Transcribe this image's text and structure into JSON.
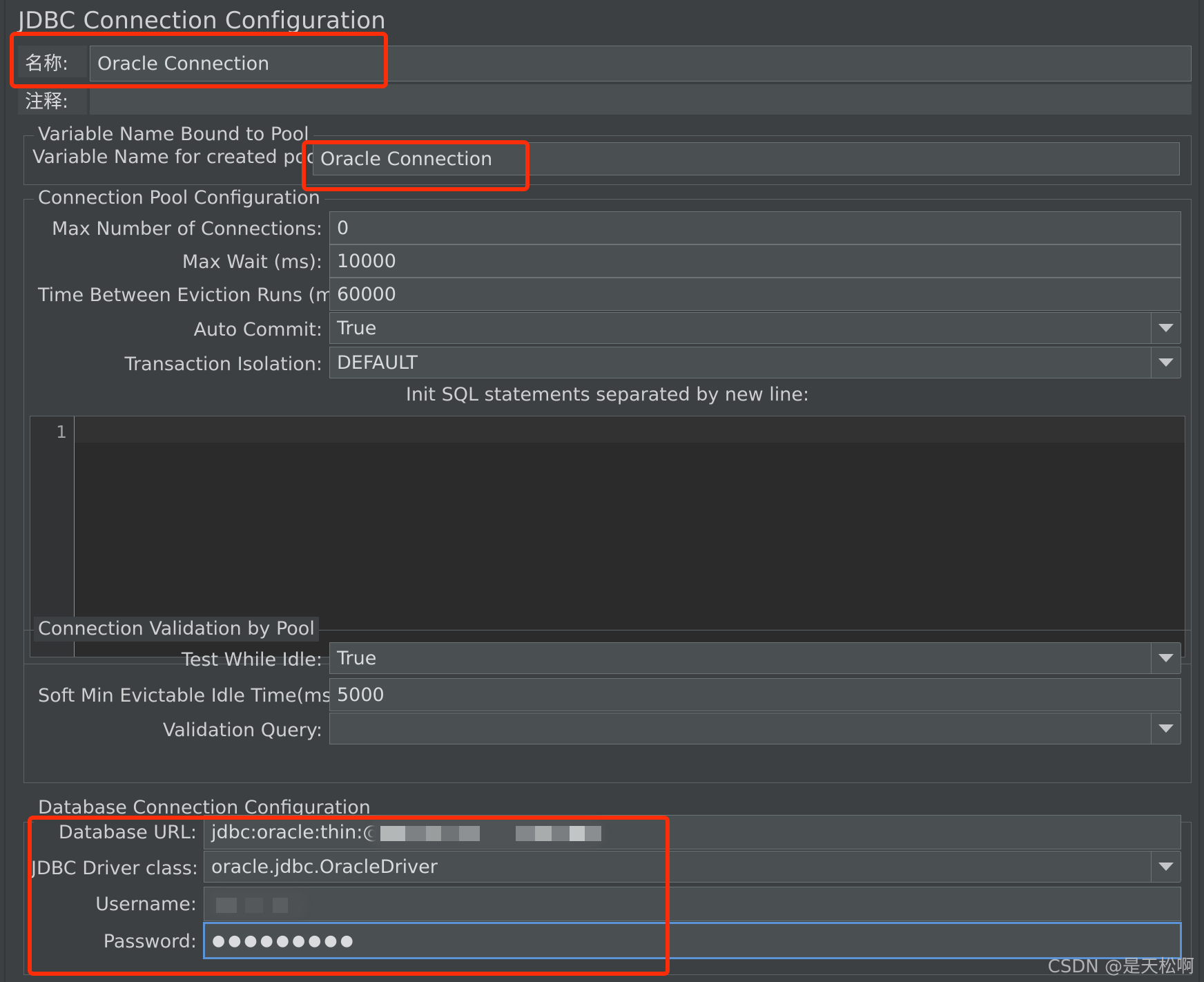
{
  "window": {
    "title": "JDBC Connection Configuration"
  },
  "header": {
    "name_label": "名称:",
    "name_value": "Oracle Connection",
    "comment_label": "注释:",
    "comment_value": ""
  },
  "variable_group": {
    "title": "Variable Name Bound to Pool",
    "pool_label": "Variable Name for created pool",
    "pool_value": "Oracle Connection"
  },
  "pool_group": {
    "title": "Connection Pool Configuration",
    "rows": [
      {
        "label": "Max Number of Connections:",
        "value": "0",
        "type": "text"
      },
      {
        "label": "Max Wait (ms):",
        "value": "10000",
        "type": "text"
      },
      {
        "label": "Time Between Eviction Runs (ms):",
        "value": "60000",
        "type": "text"
      },
      {
        "label": "Auto Commit:",
        "value": "True",
        "type": "combo"
      },
      {
        "label": "Transaction Isolation:",
        "value": "DEFAULT",
        "type": "combo"
      }
    ],
    "init_sql_label": "Init SQL statements separated by new line:",
    "init_sql_value": "",
    "init_sql_line_number": "1"
  },
  "validation_group": {
    "title": "Connection Validation by Pool",
    "rows": [
      {
        "label": "Test While Idle:",
        "value": "True",
        "type": "combo"
      },
      {
        "label": "Soft Min Evictable Idle Time(ms):",
        "value": "5000",
        "type": "text"
      },
      {
        "label": "Validation Query:",
        "value": "",
        "type": "combo"
      }
    ]
  },
  "database_group": {
    "title": "Database Connection Configuration",
    "rows": [
      {
        "label": "Database URL:",
        "value": "jdbc:oracle:thin:@",
        "type": "text",
        "redacted": true
      },
      {
        "label": "JDBC Driver class:",
        "value": "oracle.jdbc.OracleDriver",
        "type": "combo"
      },
      {
        "label": "Username:",
        "value": "",
        "type": "text",
        "redacted": true
      },
      {
        "label": "Password:",
        "value": "●●●●●●●●●",
        "type": "password",
        "focused": true
      }
    ]
  },
  "icons": {
    "dropdown": "chevron-down-icon"
  },
  "colors": {
    "background": "#3c4043",
    "field": "#4a4f52",
    "border": "#6d7477",
    "text": "#d9dbdc",
    "annotation": "#fb2e09",
    "focus": "#5b93d6",
    "editor_bg": "#2b2b2b"
  },
  "watermark": {
    "text": "CSDN @是天松啊"
  }
}
